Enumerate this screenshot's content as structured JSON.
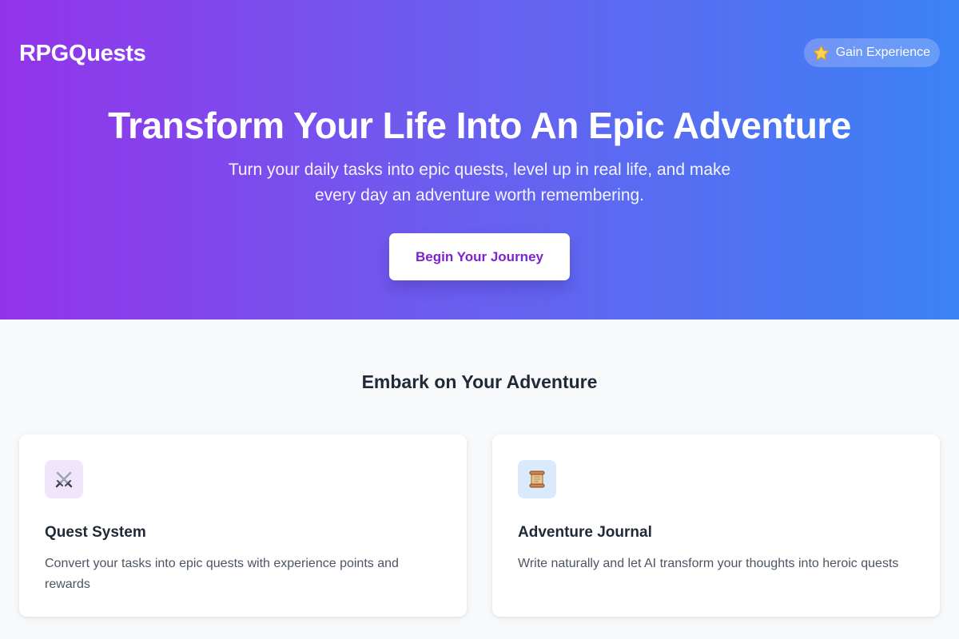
{
  "header": {
    "brand": "RPGQuests",
    "xp_button_label": "Gain Experience",
    "xp_button_icon": "star-icon"
  },
  "hero": {
    "title": "Transform Your Life Into An Epic Adventure",
    "subtitle": "Turn your daily tasks into epic quests, level up in real life, and make every day an adventure worth remembering.",
    "cta_label": "Begin Your Journey"
  },
  "features": {
    "title": "Embark on Your Adventure",
    "cards": [
      {
        "icon": "crossed-swords-icon",
        "title": "Quest System",
        "text": "Convert your tasks into epic quests with experience points and rewards"
      },
      {
        "icon": "scroll-icon",
        "title": "Adventure Journal",
        "text": "Write naturally and let AI transform your thoughts into heroic quests"
      }
    ]
  },
  "colors": {
    "gradient_start": "#9333ea",
    "gradient_end": "#3b82f6",
    "cta_text": "#7e22ce",
    "page_background": "#f8f9fb"
  }
}
